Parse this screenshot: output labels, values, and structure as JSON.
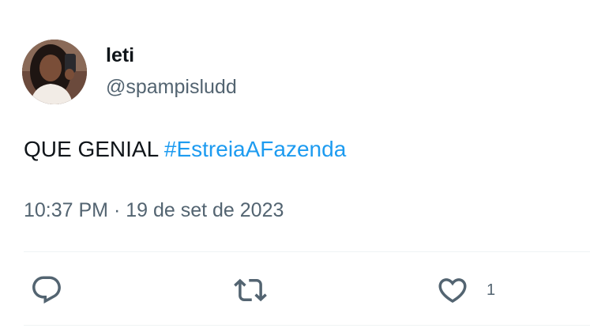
{
  "tweet": {
    "author": {
      "display_name": "leti",
      "handle": "@spampisludd",
      "avatar_icon": "profile-photo"
    },
    "text_plain": "QUE GENIAL ",
    "hashtag": "#EstreiaAFazenda",
    "timestamp": "10:37 PM · 19 de set de 2023",
    "actions": {
      "reply_icon": "reply-bubble-icon",
      "retweet_icon": "retweet-arrows-icon",
      "like_icon": "heart-icon",
      "like_count": "1"
    }
  },
  "colors": {
    "text": "#0f1419",
    "secondary": "#536471",
    "link": "#1d9bf0",
    "divider": "#eff3f4"
  }
}
